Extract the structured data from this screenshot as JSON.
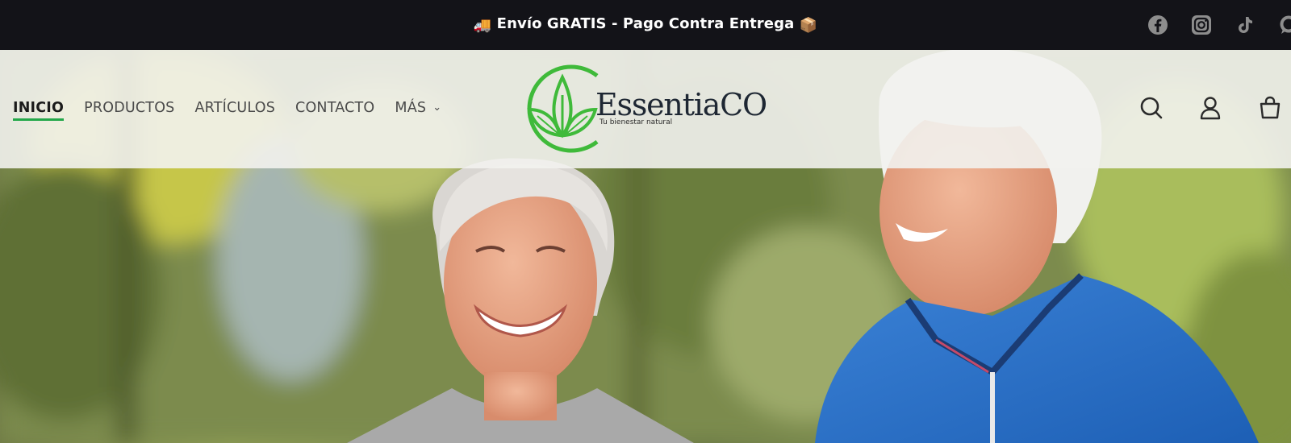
{
  "announcement": {
    "truck_emoji": "🚚",
    "text": "Envío GRATIS -  Pago Contra Entrega",
    "box_emoji": "📦"
  },
  "socials": [
    "facebook-icon",
    "instagram-icon",
    "tiktok-icon",
    "whatsapp-icon"
  ],
  "nav": {
    "items": [
      {
        "label": "INICIO",
        "active": true
      },
      {
        "label": "PRODUCTOS"
      },
      {
        "label": "ARTÍCULOS"
      },
      {
        "label": "CONTACTO"
      },
      {
        "label": "MÁS",
        "has_dropdown": true
      }
    ]
  },
  "logo": {
    "brand": "EssentiaCO",
    "tagline": "Tu bienestar natural",
    "accent_color": "#3fba3a"
  },
  "header_icons": [
    "search-icon",
    "account-icon",
    "cart-icon"
  ],
  "hero": {
    "image": "smiling-senior-couple-photo"
  }
}
